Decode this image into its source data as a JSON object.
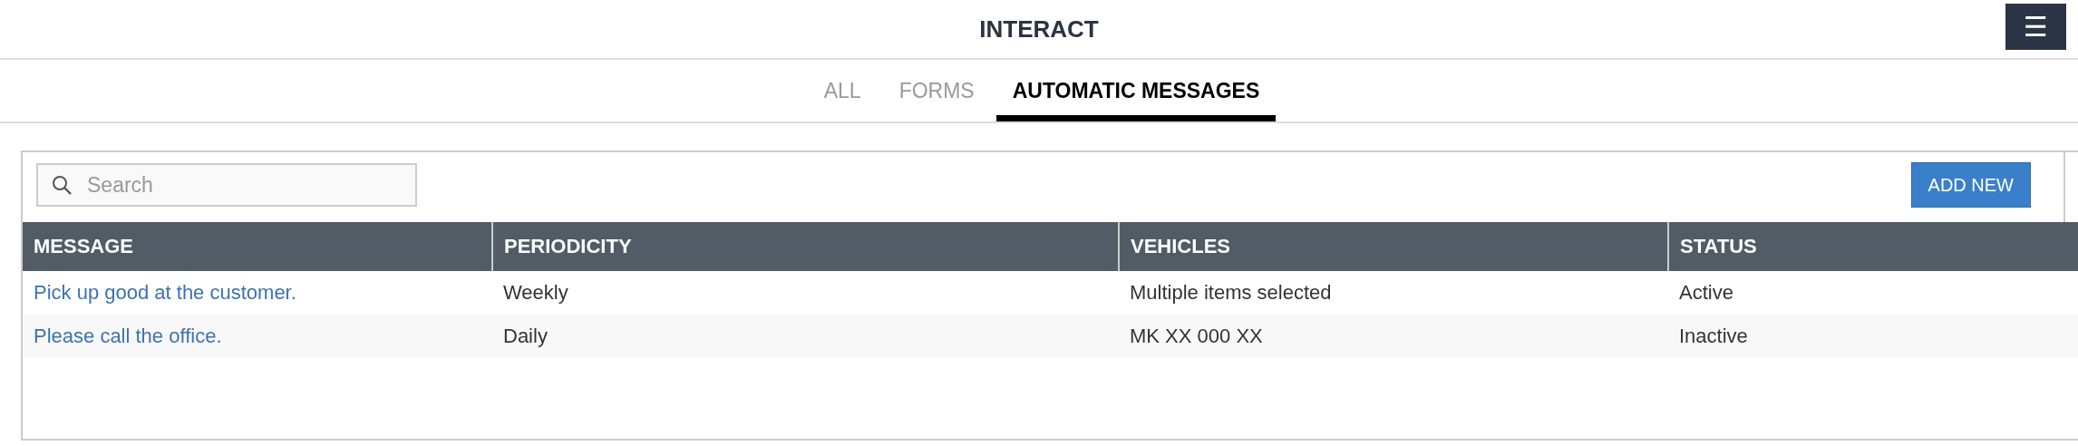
{
  "header": {
    "title": "INTERACT",
    "menu_icon": "☰"
  },
  "tabs": [
    {
      "label": "ALL",
      "selected": false
    },
    {
      "label": "FORMS",
      "selected": false
    },
    {
      "label": "AUTOMATIC MESSAGES",
      "selected": true
    }
  ],
  "search": {
    "placeholder": "Search"
  },
  "add_button": "ADD NEW",
  "table": {
    "columns": [
      "MESSAGE",
      "PERIODICITY",
      "VEHICLES",
      "STATUS"
    ],
    "rows": [
      {
        "message": "Pick up good at the customer.",
        "periodicity": "Weekly",
        "vehicles": "Multiple items selected",
        "status": "Active"
      },
      {
        "message": "Please call the office.",
        "periodicity": "Daily",
        "vehicles": "MK XX 000 XX",
        "status": "Inactive"
      }
    ]
  }
}
